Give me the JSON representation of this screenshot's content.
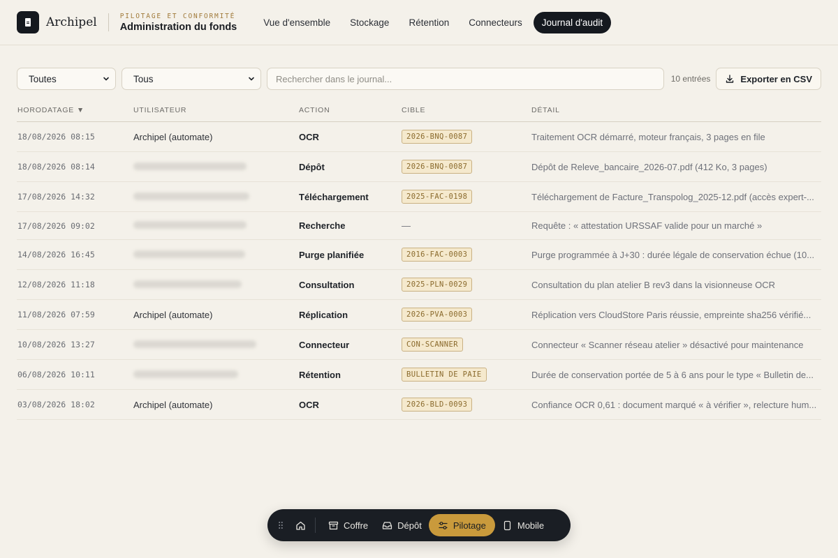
{
  "header": {
    "brand": "Archipel",
    "kicker": "PILOTAGE ET CONFORMITÉ",
    "title": "Administration du fonds",
    "tabs": [
      {
        "label": "Vue d'ensemble",
        "active": false
      },
      {
        "label": "Stockage",
        "active": false
      },
      {
        "label": "Rétention",
        "active": false
      },
      {
        "label": "Connecteurs",
        "active": false
      },
      {
        "label": "Journal d'audit",
        "active": true
      }
    ]
  },
  "toolbar": {
    "filter_user": "Toutes",
    "filter_action": "Tous",
    "search_placeholder": "Rechercher dans le journal...",
    "count": "10 entrées",
    "export_label": "Exporter en CSV"
  },
  "table": {
    "headers": {
      "timestamp": "HORODATAGE ▼",
      "user": "UTILISATEUR",
      "action": "ACTION",
      "target": "CIBLE",
      "detail": "DÉTAIL"
    },
    "rows": [
      {
        "ts": "18/08/2026 08:15",
        "user": "Archipel (automate)",
        "blurred": false,
        "action": "OCR",
        "target": "2026-BNQ-0087",
        "detail": "Traitement OCR démarré, moteur français, 3 pages en file"
      },
      {
        "ts": "18/08/2026 08:14",
        "user": "",
        "blurred": true,
        "action": "Dépôt",
        "target": "2026-BNQ-0087",
        "detail": "Dépôt de Releve_bancaire_2026-07.pdf (412 Ko, 3 pages)"
      },
      {
        "ts": "17/08/2026 14:32",
        "user": "",
        "blurred": true,
        "action": "Téléchargement",
        "target": "2025-FAC-0198",
        "detail": "Téléchargement de Facture_Transpolog_2025-12.pdf (accès expert-..."
      },
      {
        "ts": "17/08/2026 09:02",
        "user": "",
        "blurred": true,
        "action": "Recherche",
        "target": "",
        "detail": "Requête : « attestation URSSAF valide pour un marché »"
      },
      {
        "ts": "14/08/2026 16:45",
        "user": "",
        "blurred": true,
        "action": "Purge planifiée",
        "target": "2016-FAC-0003",
        "detail": "Purge programmée à J+30 : durée légale de conservation échue (10..."
      },
      {
        "ts": "12/08/2026 11:18",
        "user": "",
        "blurred": true,
        "action": "Consultation",
        "target": "2025-PLN-0029",
        "detail": "Consultation du plan atelier B rev3 dans la visionneuse OCR"
      },
      {
        "ts": "11/08/2026 07:59",
        "user": "Archipel (automate)",
        "blurred": false,
        "action": "Réplication",
        "target": "2026-PVA-0003",
        "detail": "Réplication vers CloudStore Paris réussie, empreinte sha256 vérifié..."
      },
      {
        "ts": "10/08/2026 13:27",
        "user": "",
        "blurred": true,
        "action": "Connecteur",
        "target": "CON-SCANNER",
        "detail": "Connecteur « Scanner réseau atelier » désactivé pour maintenance"
      },
      {
        "ts": "06/08/2026 10:11",
        "user": "",
        "blurred": true,
        "action": "Rétention",
        "target": "BULLETIN DE PAIE",
        "detail": "Durée de conservation portée de 5 à 6 ans pour le type « Bulletin de..."
      },
      {
        "ts": "03/08/2026 18:02",
        "user": "Archipel (automate)",
        "blurred": false,
        "action": "OCR",
        "target": "2026-BLD-0093",
        "detail": "Confiance OCR 0,61 : document marqué « à vérifier », relecture hum..."
      }
    ]
  },
  "dock": {
    "items": [
      {
        "label": "Coffre",
        "icon": "archive-icon",
        "active": false
      },
      {
        "label": "Dépôt",
        "icon": "inbox-icon",
        "active": false
      },
      {
        "label": "Pilotage",
        "icon": "sliders-icon",
        "active": true
      },
      {
        "label": "Mobile",
        "icon": "phone-icon",
        "active": false
      }
    ]
  },
  "colors": {
    "background": "#f4f1ea",
    "dark": "#15191f",
    "accent": "#c99a3c",
    "chip_bg": "#f5e9cd",
    "chip_text": "#8a6a2c"
  }
}
